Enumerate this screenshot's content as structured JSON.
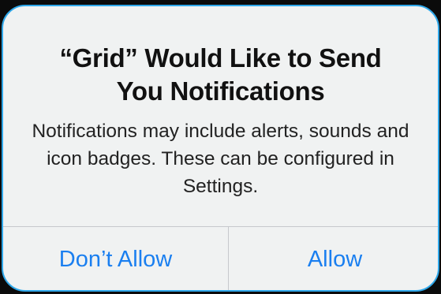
{
  "alert": {
    "title": "“Grid” Would Like to Send You Notifications",
    "message": "Notifications may include alerts, sounds and icon badges. These can be configured in Settings.",
    "buttons": {
      "dont_allow": "Don’t Allow",
      "allow": "Allow"
    }
  },
  "colors": {
    "accent": "#1a7ff0",
    "alert_background": "#f0f2f2",
    "border_highlight": "#2fa8ea"
  }
}
